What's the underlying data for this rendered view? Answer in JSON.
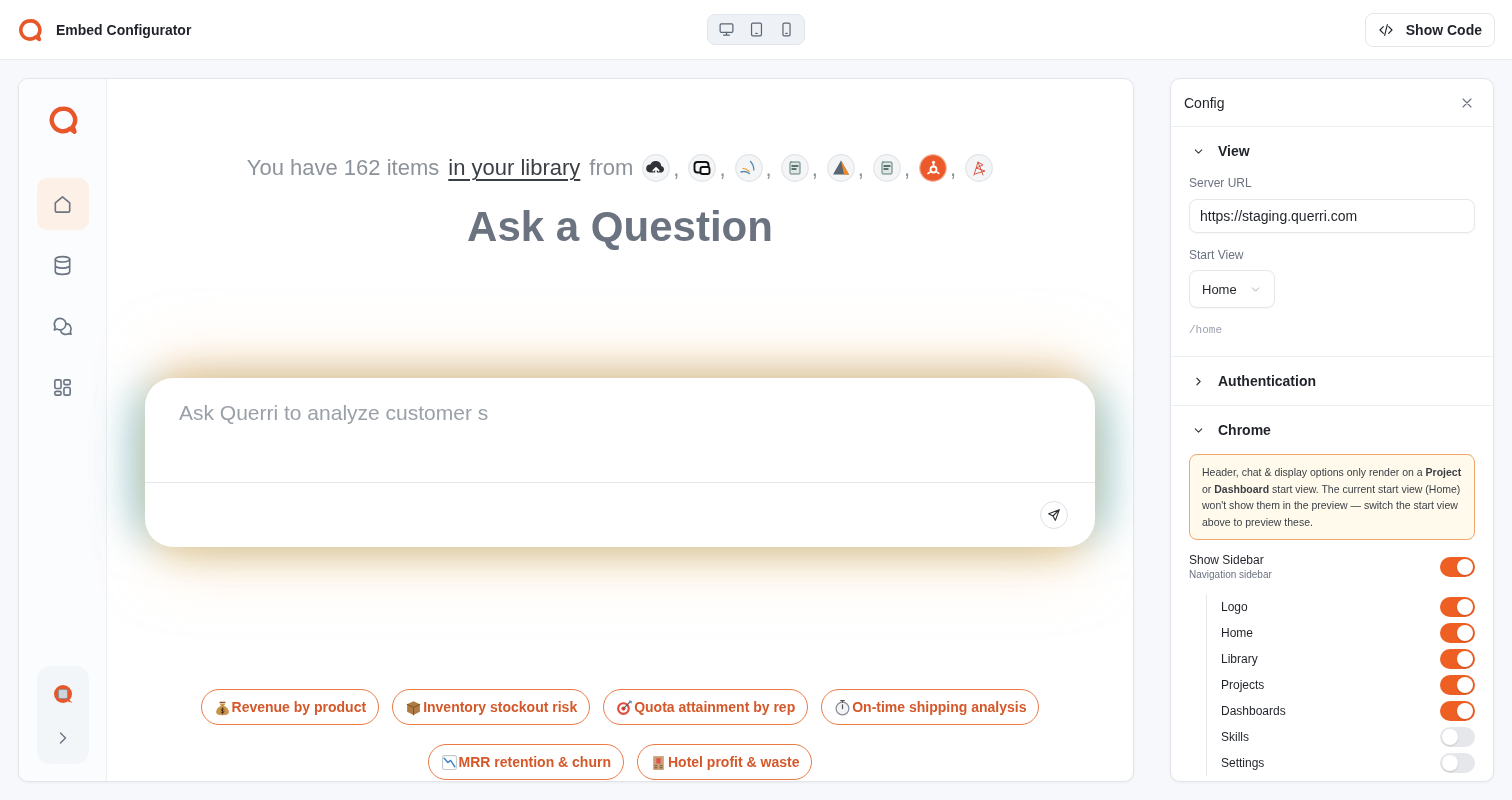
{
  "header": {
    "title": "Embed Configurator",
    "show_code_button": "Show Code"
  },
  "preview": {
    "sidebar": {
      "nav": [
        {
          "selected": true
        },
        {
          "selected": false
        },
        {
          "selected": false
        },
        {
          "selected": false
        }
      ]
    },
    "library_line": {
      "prefix": "You have 162 items",
      "link": "in your library",
      "suffix": "from",
      "separator": ","
    },
    "heading": "Ask a Question",
    "composer": {
      "placeholder": "Ask Querri to analyze customer s"
    },
    "suggestions": [
      {
        "label": "Revenue by product"
      },
      {
        "label": "Inventory stockout risk"
      },
      {
        "label": "Quota attainment by rep"
      },
      {
        "label": "On-time shipping analysis"
      },
      {
        "label": "MRR retention & churn"
      },
      {
        "label": "Hotel profit & waste"
      }
    ]
  },
  "config": {
    "title": "Config",
    "sections": [
      {
        "title": "View",
        "expanded": true,
        "fields": [
          {
            "kind": "text",
            "label": "Server URL",
            "value": "https://staging.querri.com"
          },
          {
            "kind": "select",
            "label": "Start View",
            "value": "Home",
            "hint": "/home"
          }
        ]
      },
      {
        "title": "Authentication",
        "expanded": false
      },
      {
        "title": "Chrome",
        "expanded": true,
        "notice": "Header, chat & display options only render on a **Project** or **Dashboard** start view. The current start view (Home) won't show them in the preview — switch the start view above to preview these.",
        "toggles": [
          {
            "label": "Show Sidebar",
            "description": "Navigation sidebar",
            "on": true,
            "children": [
              {
                "label": "Logo",
                "on": true
              },
              {
                "label": "Home",
                "on": true
              },
              {
                "label": "Library",
                "on": true
              },
              {
                "label": "Projects",
                "on": true
              },
              {
                "label": "Dashboards",
                "on": true
              },
              {
                "label": "Skills",
                "on": false
              },
              {
                "label": "Settings",
                "on": false
              }
            ]
          }
        ]
      }
    ]
  }
}
